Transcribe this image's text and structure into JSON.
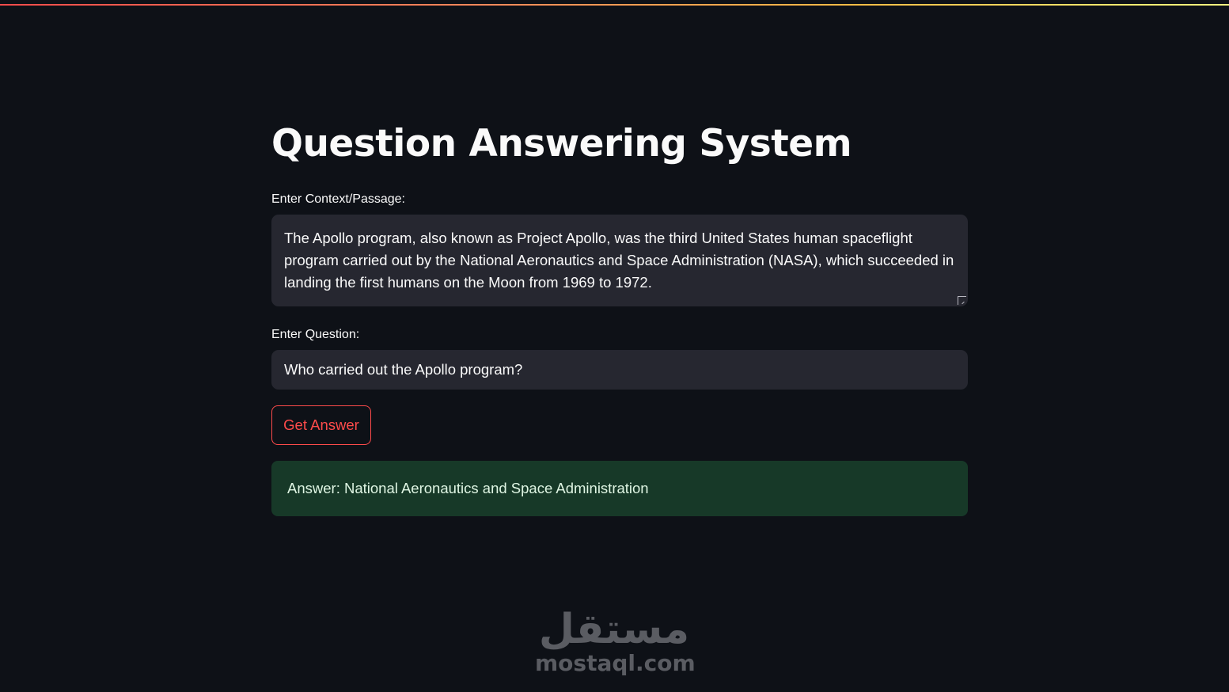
{
  "app": {
    "title": "Question Answering System"
  },
  "context_field": {
    "label": "Enter Context/Passage:",
    "value": "The Apollo program, also known as Project Apollo, was the third United States human spaceflight program carried out by the National Aeronautics and Space Administration (NASA), which succeeded in landing the first humans on the Moon from 1969 to 1972."
  },
  "question_field": {
    "label": "Enter Question:",
    "value": "Who carried out the Apollo program?"
  },
  "actions": {
    "get_answer_label": "Get Answer"
  },
  "result": {
    "text": "Answer: National Aeronautics and Space Administration"
  },
  "watermark": {
    "arabic": "مستقل",
    "latin": "mostaql.com"
  },
  "colors": {
    "background": "#0e1117",
    "input_background": "#262730",
    "accent": "#ff4b4b",
    "success_background": "#173928",
    "text": "#fafafa"
  }
}
